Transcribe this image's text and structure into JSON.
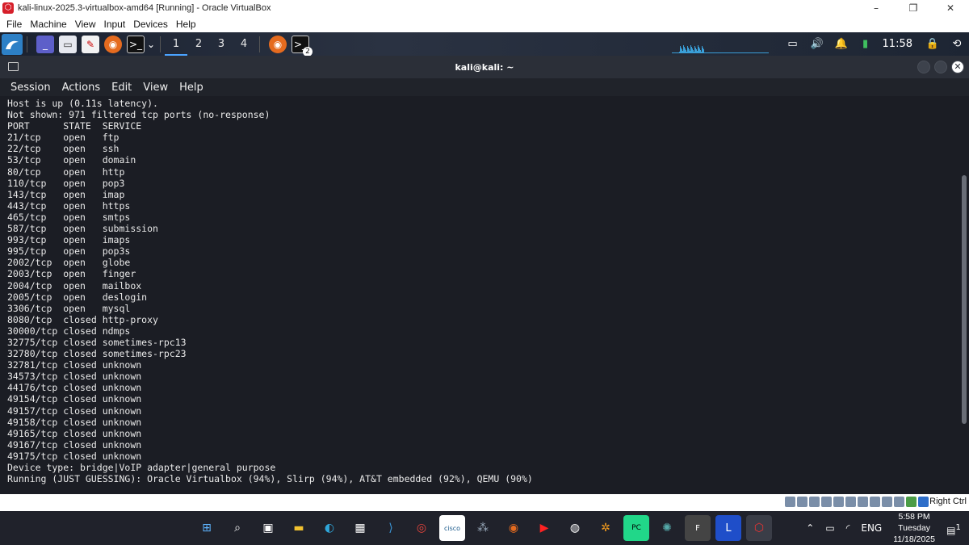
{
  "vbox": {
    "title": "kali-linux-2025.3-virtualbox-amd64 [Running] - Oracle VirtualBox",
    "menu": [
      "File",
      "Machine",
      "View",
      "Input",
      "Devices",
      "Help"
    ],
    "status_right": "Right Ctrl"
  },
  "kali_panel": {
    "workspaces": [
      "1",
      "2",
      "3",
      "4"
    ],
    "active_workspace": "1",
    "terminal_badge": "2",
    "clock": "11:58"
  },
  "terminal": {
    "title": "kali@kali: ~",
    "menu": [
      "Session",
      "Actions",
      "Edit",
      "View",
      "Help"
    ],
    "lines": [
      "Host is up (0.11s latency).",
      "Not shown: 971 filtered tcp ports (no-response)",
      "PORT      STATE  SERVICE",
      "21/tcp    open   ftp",
      "22/tcp    open   ssh",
      "53/tcp    open   domain",
      "80/tcp    open   http",
      "110/tcp   open   pop3",
      "143/tcp   open   imap",
      "443/tcp   open   https",
      "465/tcp   open   smtps",
      "587/tcp   open   submission",
      "993/tcp   open   imaps",
      "995/tcp   open   pop3s",
      "2002/tcp  open   globe",
      "2003/tcp  open   finger",
      "2004/tcp  open   mailbox",
      "2005/tcp  open   deslogin",
      "3306/tcp  open   mysql",
      "8080/tcp  closed http-proxy",
      "30000/tcp closed ndmps",
      "32775/tcp closed sometimes-rpc13",
      "32780/tcp closed sometimes-rpc23",
      "32781/tcp closed unknown",
      "34573/tcp closed unknown",
      "44176/tcp closed unknown",
      "49154/tcp closed unknown",
      "49157/tcp closed unknown",
      "49158/tcp closed unknown",
      "49165/tcp closed unknown",
      "49167/tcp closed unknown",
      "49175/tcp closed unknown",
      "Device type: bridge|VoIP adapter|general purpose",
      "Running (JUST GUESSING): Oracle Virtualbox (94%), Slirp (94%), AT&T embedded (92%), QEMU (90%)"
    ]
  },
  "taskbar": {
    "lang": "ENG",
    "time": "5:58 PM",
    "day": "Tuesday",
    "date": "11/18/2025",
    "notification_count": "1"
  }
}
